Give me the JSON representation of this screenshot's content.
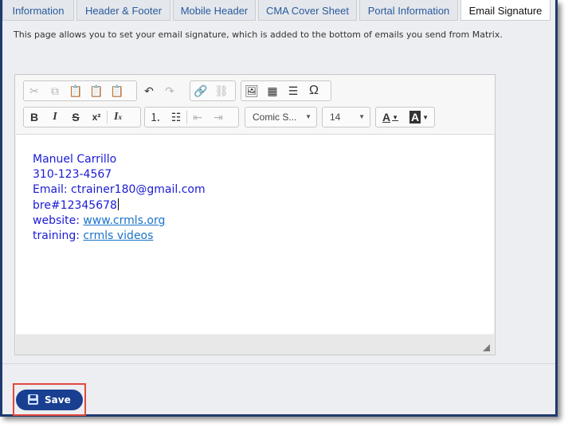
{
  "tabs": [
    {
      "label": "Information"
    },
    {
      "label": "Header & Footer"
    },
    {
      "label": "Mobile Header"
    },
    {
      "label": "CMA Cover Sheet"
    },
    {
      "label": "Portal Information"
    },
    {
      "label": "Email Signature",
      "active": true
    }
  ],
  "intro_text": "This page allows you to set your email signature, which is added to the bottom of emails you send from Matrix.",
  "toolbar": {
    "font_name": "Comic S...",
    "font_size": "14",
    "text_color_label": "A",
    "bg_color_label": "A"
  },
  "signature": {
    "name": "Manuel Carrillo",
    "phone": "310-123-4567",
    "email": "Email: ctrainer180@gmail.com",
    "bre": "bre#12345678",
    "website_label": "website: ",
    "website_link": "www.crmls.org",
    "training_label": "training: ",
    "training_link": "crmls videos"
  },
  "save_label": "Save",
  "colors": {
    "frame_border": "#1f3a6e",
    "tab_text": "#2a5a9e",
    "signature_text": "#1a1ad6",
    "link": "#1a73c9",
    "save_button": "#193f91",
    "highlight": "#e24a3e"
  }
}
